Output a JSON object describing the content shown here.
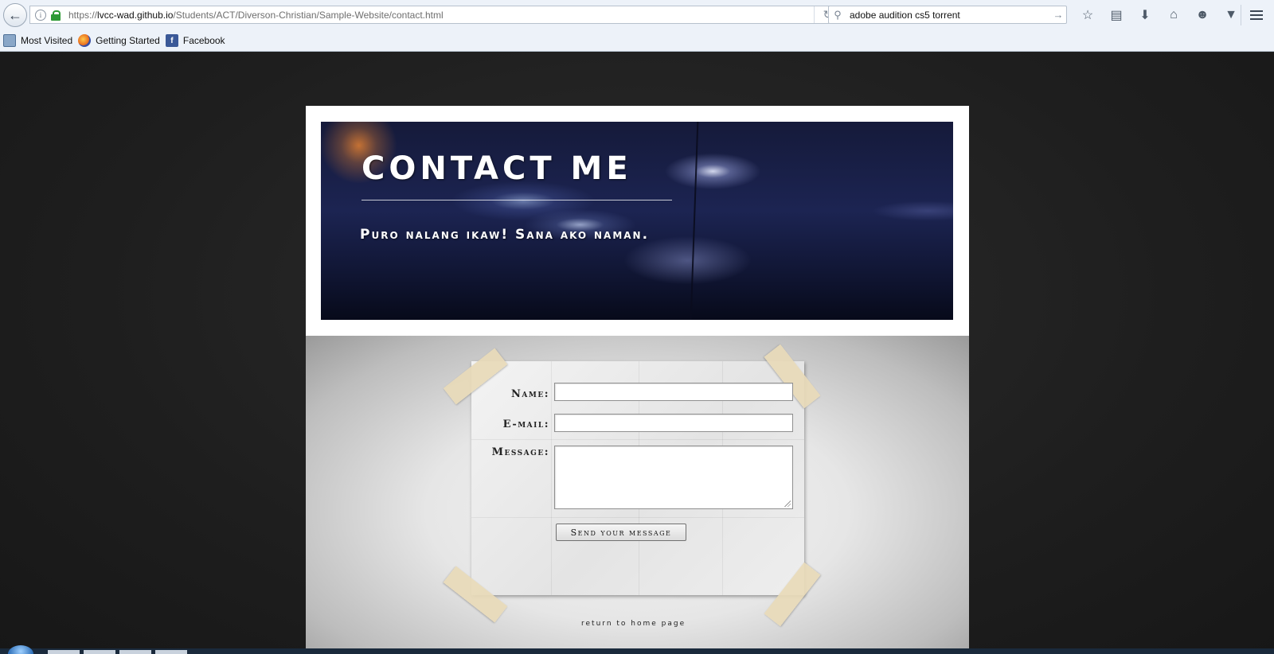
{
  "browser": {
    "url_host": "lvcc-wad.github.io",
    "url_prefix": "https://",
    "url_path": "/Students/ACT/Diverson-Christian/Sample-Website/contact.html",
    "search_query": "adobe audition cs5 torrent",
    "bookmarks": [
      {
        "label": "Most Visited",
        "icon": "most-visited-icon"
      },
      {
        "label": "Getting Started",
        "icon": "firefox-icon"
      },
      {
        "label": "Facebook",
        "icon": "facebook-icon"
      }
    ]
  },
  "page": {
    "title": "CONTACT ME",
    "subtitle": "Puro nalang ikaw! Sana ako naman.",
    "form": {
      "name_label": "Name:",
      "email_label": "E-mail:",
      "message_label": "Message:",
      "name_value": "",
      "email_value": "",
      "message_value": "",
      "submit_label": "Send your message"
    },
    "return_link": "return to home page"
  },
  "colors": {
    "page_background": "#1f1f1f",
    "header_box": "#ffffff",
    "banner_dark": "#151a3a",
    "tape": "#e8dab9"
  }
}
